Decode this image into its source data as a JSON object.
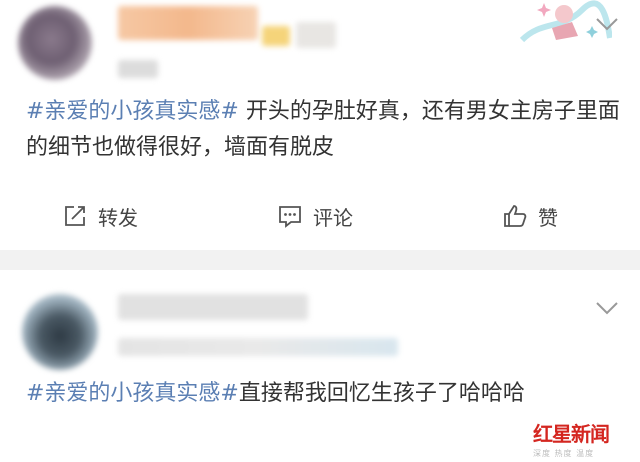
{
  "posts": [
    {
      "topic": "#亲爱的小孩真实感#",
      "body": " 开头的孕肚好真，还有男女主房子里面的细节也做得很好，墙面有脱皮"
    },
    {
      "topic": "#亲爱的小孩真实感#",
      "body": "直接帮我回忆生孩子了哈哈哈"
    }
  ],
  "actions": {
    "repost_label": "转发",
    "comment_label": "评论",
    "like_label": "赞"
  },
  "watermark": {
    "title": "红星新闻",
    "subtitle": "深度 热度 温度"
  },
  "colors": {
    "topic_link": "#5b7fb3",
    "separator": "#f2f2f2",
    "brand_red": "#d42620"
  },
  "icons": [
    "chevron-down-icon",
    "repost-icon",
    "comment-icon",
    "like-icon"
  ]
}
